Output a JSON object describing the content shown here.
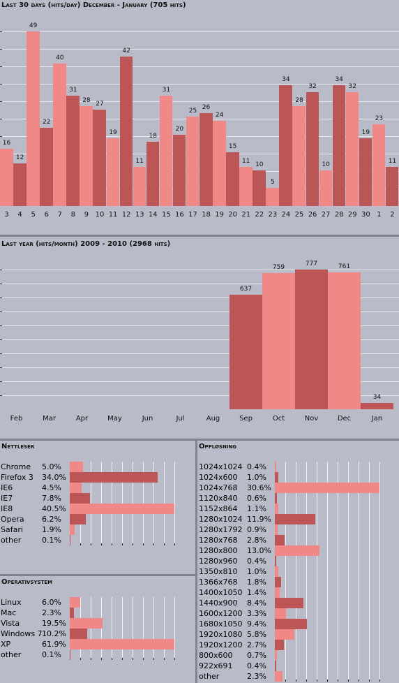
{
  "colors": {
    "light": "#f08888",
    "dark": "#bc5555",
    "background": "#b9bcc8",
    "divider": "#80838f"
  },
  "chart_data": [
    {
      "type": "bar",
      "title": "Last 30 days (hits/day) December - January (705 hits)",
      "categories": [
        "3",
        "4",
        "5",
        "6",
        "7",
        "8",
        "9",
        "10",
        "11",
        "12",
        "13",
        "14",
        "15",
        "16",
        "17",
        "18",
        "19",
        "20",
        "21",
        "22",
        "23",
        "24",
        "25",
        "26",
        "27",
        "28",
        "29",
        "30",
        "1",
        "2"
      ],
      "values": [
        16,
        12,
        49,
        22,
        40,
        31,
        28,
        27,
        19,
        42,
        11,
        18,
        31,
        20,
        25,
        26,
        24,
        15,
        11,
        10,
        5,
        34,
        28,
        32,
        10,
        34,
        32,
        19,
        23,
        11
      ],
      "ylim": [
        0,
        49
      ],
      "grid": true
    },
    {
      "type": "bar",
      "title": "Last year (hits/month) 2009 - 2010 (2968 hits)",
      "categories": [
        "Feb",
        "Mar",
        "Apr",
        "May",
        "Jun",
        "Jul",
        "Aug",
        "Sep",
        "Oct",
        "Nov",
        "Dec",
        "Jan"
      ],
      "values": [
        0,
        0,
        0,
        0,
        0,
        0,
        0,
        637,
        759,
        777,
        761,
        34
      ],
      "ylim": [
        0,
        777
      ],
      "grid": true
    },
    {
      "type": "bar",
      "orientation": "horizontal",
      "title": "Nettleser",
      "categories": [
        "Chrome",
        "Firefox 3",
        "IE6",
        "IE7",
        "IE8",
        "Opera",
        "Safari",
        "other"
      ],
      "labels": [
        "5.0%",
        "34.0%",
        "4.5%",
        "7.8%",
        "40.5%",
        "6.2%",
        "1.9%",
        "0.1%"
      ],
      "values": [
        5.0,
        34.0,
        4.5,
        7.8,
        40.5,
        6.2,
        1.9,
        0.1
      ]
    },
    {
      "type": "bar",
      "orientation": "horizontal",
      "title": "Operativsystem",
      "categories": [
        "Linux",
        "Mac",
        "Vista",
        "Windows 7",
        "XP",
        "other"
      ],
      "labels": [
        "6.0%",
        "2.3%",
        "19.5%",
        "10.2%",
        "61.9%",
        "0.1%"
      ],
      "values": [
        6.0,
        2.3,
        19.5,
        10.2,
        61.9,
        0.1
      ]
    },
    {
      "type": "bar",
      "orientation": "horizontal",
      "title": "Oppløsning",
      "categories": [
        "1024x1024",
        "1024x600",
        "1024x768",
        "1120x840",
        "1152x864",
        "1280x1024",
        "1280x1792",
        "1280x768",
        "1280x800",
        "1280x960",
        "1350x810",
        "1366x768",
        "1400x1050",
        "1440x900",
        "1600x1200",
        "1680x1050",
        "1920x1080",
        "1920x1200",
        "800x600",
        "922x691",
        "other"
      ],
      "labels": [
        "0.4%",
        "1.0%",
        "30.6%",
        "0.6%",
        "1.1%",
        "11.9%",
        "0.9%",
        "2.8%",
        "13.0%",
        "0.4%",
        "1.0%",
        "1.8%",
        "1.4%",
        "8.4%",
        "3.3%",
        "9.4%",
        "5.8%",
        "2.7%",
        "0.7%",
        "0.4%",
        "2.3%"
      ],
      "values": [
        0.4,
        1.0,
        30.6,
        0.6,
        1.1,
        11.9,
        0.9,
        2.8,
        13.0,
        0.4,
        1.0,
        1.8,
        1.4,
        8.4,
        3.3,
        9.4,
        5.8,
        2.7,
        0.7,
        0.4,
        2.3
      ]
    }
  ]
}
